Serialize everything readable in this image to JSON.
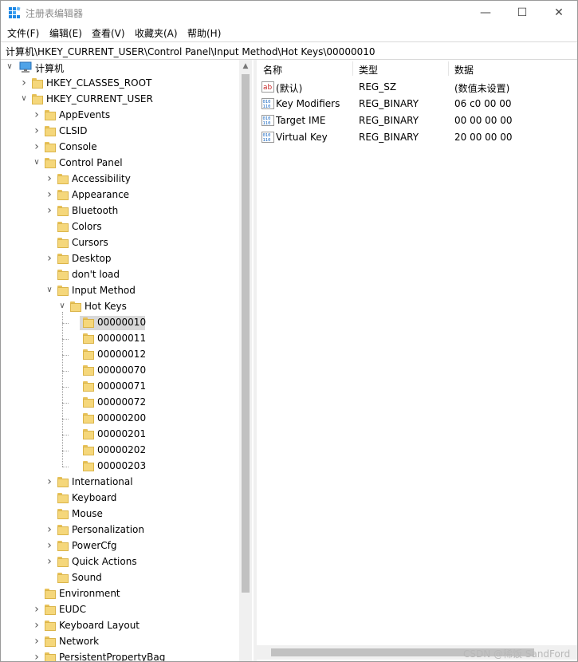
{
  "window": {
    "title": "注册表编辑器",
    "minimize_glyph": "—",
    "maximize_glyph": "☐",
    "close_glyph": "✕"
  },
  "menu": [
    "文件(F)",
    "编辑(E)",
    "查看(V)",
    "收藏夹(A)",
    "帮助(H)"
  ],
  "address": "计算机\\HKEY_CURRENT_USER\\Control Panel\\Input Method\\Hot Keys\\00000010",
  "tree": {
    "root": "计算机",
    "items": [
      {
        "label": "HKEY_CLASSES_ROOT",
        "level": 1,
        "expander": "collapsed"
      },
      {
        "label": "HKEY_CURRENT_USER",
        "level": 1,
        "expander": "expanded"
      },
      {
        "label": "AppEvents",
        "level": 2,
        "expander": "collapsed"
      },
      {
        "label": "CLSID",
        "level": 2,
        "expander": "collapsed"
      },
      {
        "label": "Console",
        "level": 2,
        "expander": "collapsed"
      },
      {
        "label": "Control Panel",
        "level": 2,
        "expander": "expanded"
      },
      {
        "label": "Accessibility",
        "level": 3,
        "expander": "collapsed"
      },
      {
        "label": "Appearance",
        "level": 3,
        "expander": "collapsed"
      },
      {
        "label": "Bluetooth",
        "level": 3,
        "expander": "collapsed"
      },
      {
        "label": "Colors",
        "level": 3,
        "expander": "none"
      },
      {
        "label": "Cursors",
        "level": 3,
        "expander": "none"
      },
      {
        "label": "Desktop",
        "level": 3,
        "expander": "collapsed"
      },
      {
        "label": "don't load",
        "level": 3,
        "expander": "none"
      },
      {
        "label": "Input Method",
        "level": 3,
        "expander": "expanded"
      },
      {
        "label": "Hot Keys",
        "level": 4,
        "expander": "expanded"
      },
      {
        "label": "00000010",
        "level": 5,
        "expander": "none",
        "selected": true
      },
      {
        "label": "00000011",
        "level": 5,
        "expander": "none"
      },
      {
        "label": "00000012",
        "level": 5,
        "expander": "none"
      },
      {
        "label": "00000070",
        "level": 5,
        "expander": "none"
      },
      {
        "label": "00000071",
        "level": 5,
        "expander": "none"
      },
      {
        "label": "00000072",
        "level": 5,
        "expander": "none"
      },
      {
        "label": "00000200",
        "level": 5,
        "expander": "none"
      },
      {
        "label": "00000201",
        "level": 5,
        "expander": "none"
      },
      {
        "label": "00000202",
        "level": 5,
        "expander": "none"
      },
      {
        "label": "00000203",
        "level": 5,
        "expander": "none"
      },
      {
        "label": "International",
        "level": 3,
        "expander": "collapsed"
      },
      {
        "label": "Keyboard",
        "level": 3,
        "expander": "none"
      },
      {
        "label": "Mouse",
        "level": 3,
        "expander": "none"
      },
      {
        "label": "Personalization",
        "level": 3,
        "expander": "collapsed"
      },
      {
        "label": "PowerCfg",
        "level": 3,
        "expander": "collapsed"
      },
      {
        "label": "Quick Actions",
        "level": 3,
        "expander": "collapsed"
      },
      {
        "label": "Sound",
        "level": 3,
        "expander": "none"
      },
      {
        "label": "Environment",
        "level": 2,
        "expander": "none"
      },
      {
        "label": "EUDC",
        "level": 2,
        "expander": "collapsed"
      },
      {
        "label": "Keyboard Layout",
        "level": 2,
        "expander": "collapsed"
      },
      {
        "label": "Network",
        "level": 2,
        "expander": "collapsed"
      },
      {
        "label": "PersistentPropertyBag",
        "level": 2,
        "expander": "collapsed"
      }
    ]
  },
  "list": {
    "columns": [
      "名称",
      "类型",
      "数据"
    ],
    "rows": [
      {
        "icon": "string-value-icon",
        "name": "(默认)",
        "type": "REG_SZ",
        "data": "(数值未设置)"
      },
      {
        "icon": "binary-value-icon",
        "name": "Key Modifiers",
        "type": "REG_BINARY",
        "data": "06 c0 00 00"
      },
      {
        "icon": "binary-value-icon",
        "name": "Target IME",
        "type": "REG_BINARY",
        "data": "00 00 00 00"
      },
      {
        "icon": "binary-value-icon",
        "name": "Virtual Key",
        "type": "REG_BINARY",
        "data": "20 00 00 00"
      }
    ]
  },
  "watermark": "CSDN @稀饭 SandFord",
  "colors": {
    "folder": "#f5d77b",
    "selection": "#d9d9d9",
    "accent": "#0078d7"
  }
}
